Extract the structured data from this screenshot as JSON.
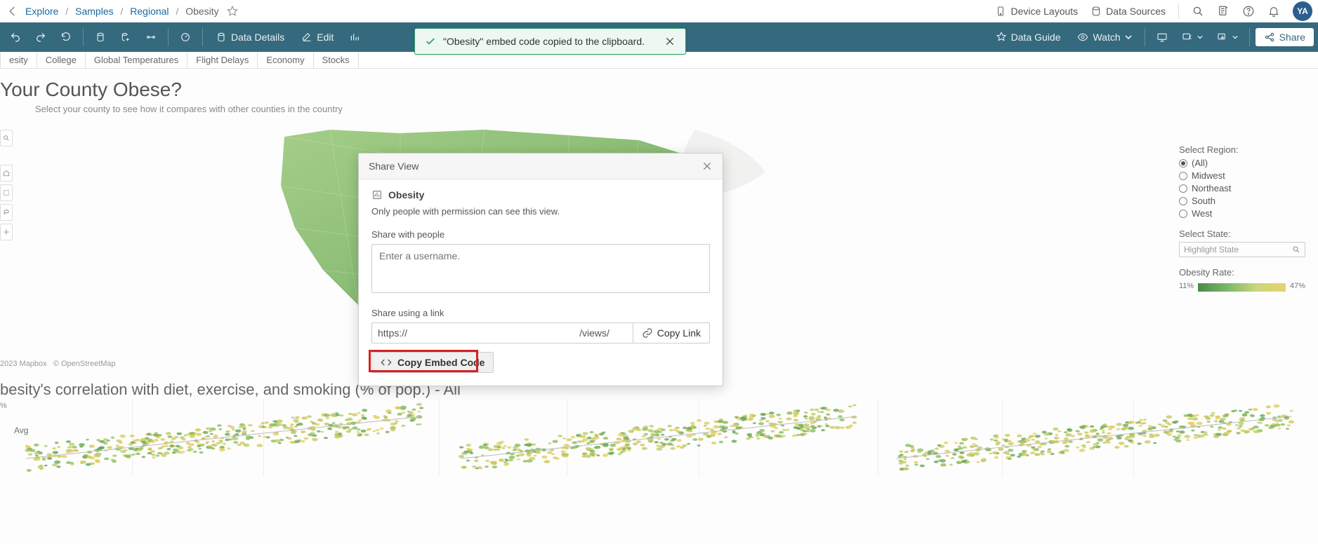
{
  "breadcrumb": {
    "explore": "Explore",
    "samples": "Samples",
    "regional": "Regional",
    "current": "Obesity"
  },
  "topbar": {
    "device_layouts": "Device Layouts",
    "data_sources": "Data Sources",
    "avatar": "YA"
  },
  "toolbar": {
    "data_details": "Data Details",
    "edit": "Edit",
    "data_guide": "Data Guide",
    "watch": "Watch",
    "share": "Share"
  },
  "toast": {
    "message": "\"Obesity\" embed code copied to the clipboard."
  },
  "tabs": [
    "esity",
    "College",
    "Global Temperatures",
    "Flight Delays",
    "Economy",
    "Stocks"
  ],
  "page": {
    "title": "Your County Obese?",
    "subtitle": "Select your county to see how it compares with other counties in the country"
  },
  "map_attrib": {
    "mapbox": "2023 Mapbox",
    "osm": "© OpenStreetMap"
  },
  "filters": {
    "region_label": "Select Region:",
    "regions": [
      {
        "label": "(All)",
        "checked": true
      },
      {
        "label": "Midwest",
        "checked": false
      },
      {
        "label": "Northeast",
        "checked": false
      },
      {
        "label": "South",
        "checked": false
      },
      {
        "label": "West",
        "checked": false
      }
    ],
    "state_label": "Select State:",
    "state_placeholder": "Highlight State",
    "rate_label": "Obesity Rate:",
    "rate_min": "11%",
    "rate_max": "47%"
  },
  "scatter": {
    "title": "besity's correlation with diet, exercise, and smoking (% of pop.) - All",
    "ytick": "%",
    "avg": "Avg"
  },
  "modal": {
    "title": "Share View",
    "view_name": "Obesity",
    "permission_text": "Only people with permission can see this view.",
    "share_people_label": "Share with people",
    "user_placeholder": "Enter a username.",
    "share_link_label": "Share using a link",
    "link_value": "https://                                                               /views/",
    "copy_link": "Copy Link",
    "copy_embed": "Copy Embed Code"
  }
}
